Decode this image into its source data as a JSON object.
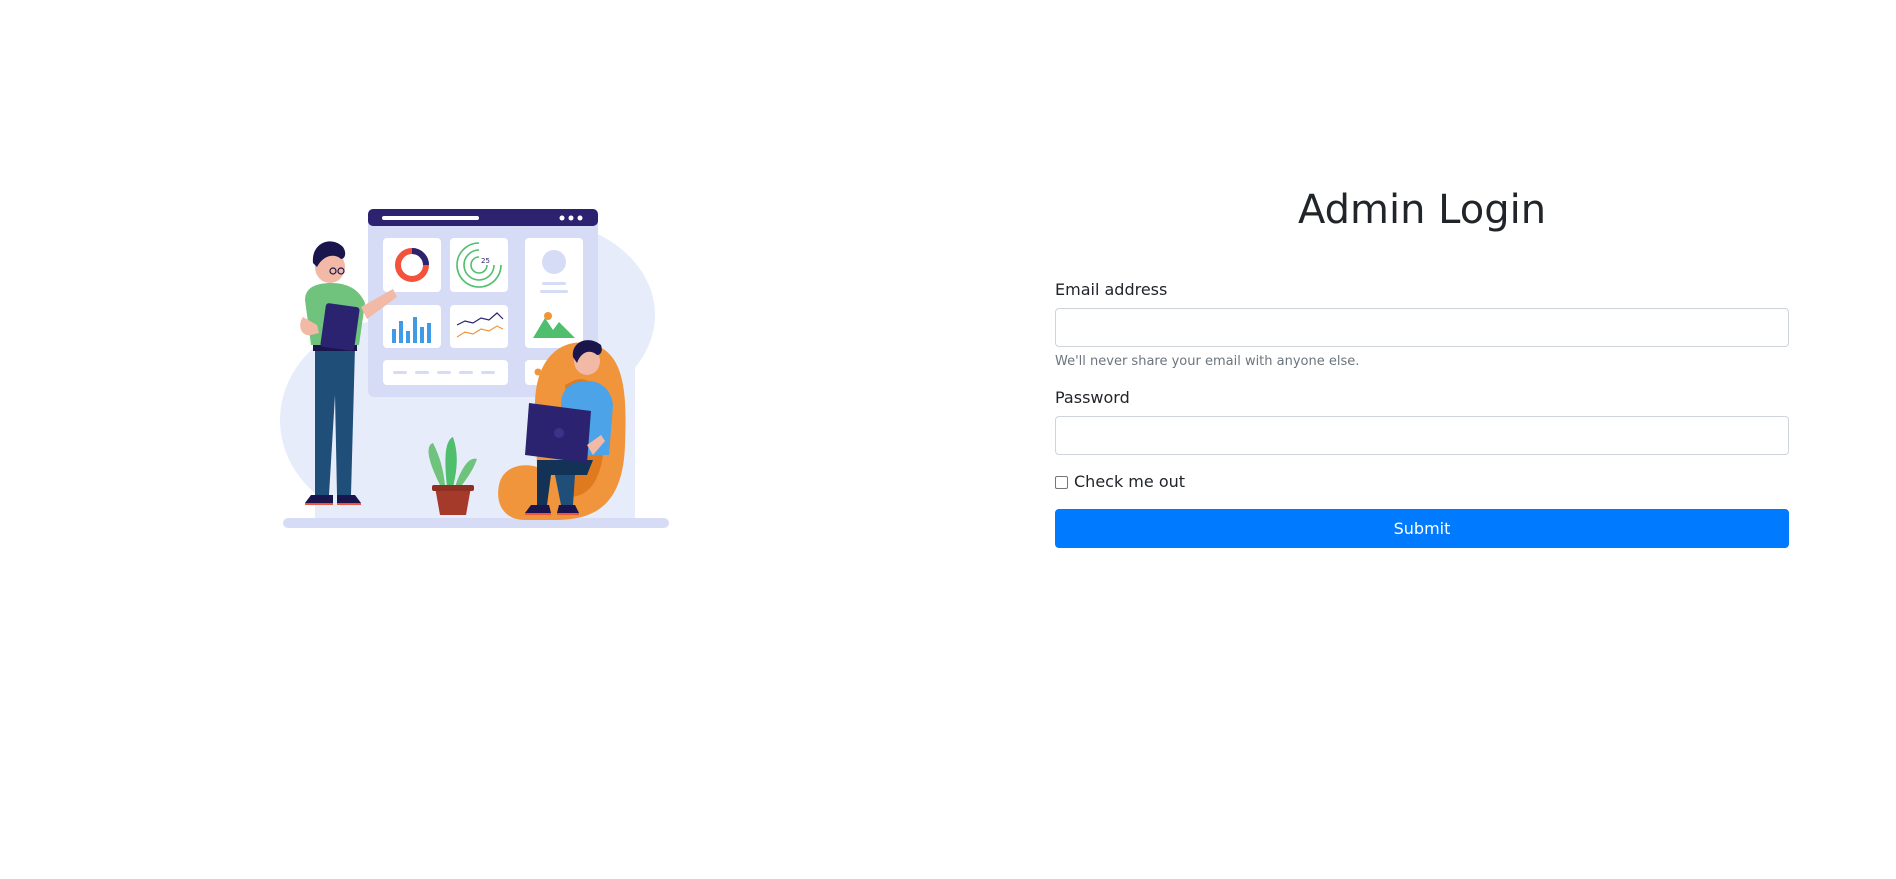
{
  "illustration": {
    "icon": "dashboard-team-illustration",
    "gauge_text": "25",
    "colors": {
      "board_header": "#2b2370",
      "board_bg": "#d6dcf5",
      "blob_bg": "#e7ecfb",
      "accent_red": "#f3533a",
      "accent_green": "#4fbf6e",
      "accent_blue": "#3f9be6",
      "chair_orange": "#f0953b",
      "shirt_green": "#6fc37c",
      "shirt_blue": "#4da3e8"
    }
  },
  "form": {
    "title": "Admin Login",
    "email": {
      "label": "Email address",
      "value": "",
      "placeholder": "",
      "help": "We'll never share your email with anyone else."
    },
    "password": {
      "label": "Password",
      "value": "",
      "placeholder": ""
    },
    "checkbox": {
      "label": "Check me out",
      "checked": false
    },
    "submit_label": "Submit",
    "colors": {
      "primary": "#007bff",
      "muted": "#6c757d",
      "border": "#ced4da"
    }
  }
}
